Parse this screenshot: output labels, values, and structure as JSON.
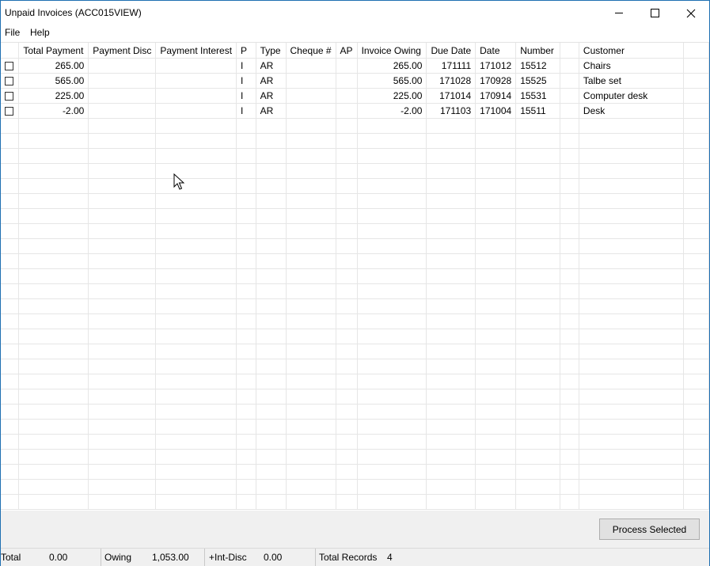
{
  "window": {
    "title": "Unpaid Invoices (ACC015VIEW)"
  },
  "menu": {
    "items": [
      {
        "label": "File"
      },
      {
        "label": "Help"
      }
    ]
  },
  "table": {
    "columns": [
      "",
      "Total Payment",
      "Payment Disc",
      "Payment Interest",
      "P",
      "Type",
      "Cheque #",
      "AP",
      "Invoice Owing",
      "Due Date",
      "Date",
      "Number",
      "",
      "Customer",
      ""
    ],
    "rows": [
      {
        "checked": false,
        "total_payment": "265.00",
        "payment_disc": "",
        "payment_interest": "",
        "p": "I",
        "type": "AR",
        "cheque": "",
        "ap": "",
        "invoice_owing": "265.00",
        "due_date": "171111",
        "date": "171012",
        "number": "15512",
        "blank": "",
        "customer": "Chairs"
      },
      {
        "checked": false,
        "total_payment": "565.00",
        "payment_disc": "",
        "payment_interest": "",
        "p": "I",
        "type": "AR",
        "cheque": "",
        "ap": "",
        "invoice_owing": "565.00",
        "due_date": "171028",
        "date": "170928",
        "number": "15525",
        "blank": "",
        "customer": "Talbe set"
      },
      {
        "checked": false,
        "total_payment": "225.00",
        "payment_disc": "",
        "payment_interest": "",
        "p": "I",
        "type": "AR",
        "cheque": "",
        "ap": "",
        "invoice_owing": "225.00",
        "due_date": "171014",
        "date": "170914",
        "number": "15531",
        "blank": "",
        "customer": "Computer desk"
      },
      {
        "checked": false,
        "total_payment": "-2.00",
        "payment_disc": "",
        "payment_interest": "",
        "p": "I",
        "type": "AR",
        "cheque": "",
        "ap": "",
        "invoice_owing": "-2.00",
        "due_date": "171103",
        "date": "171004",
        "number": "15511",
        "blank": "",
        "customer": "Desk"
      }
    ]
  },
  "actions": {
    "process_selected": "Process Selected"
  },
  "status": {
    "total_label": "Total",
    "total_value": "0.00",
    "owing_label": "Owing",
    "owing_value": "1,053.00",
    "int_disc_label": "+Int-Disc",
    "int_disc_value": "0.00",
    "records_label": "Total Records",
    "records_value": "4"
  }
}
